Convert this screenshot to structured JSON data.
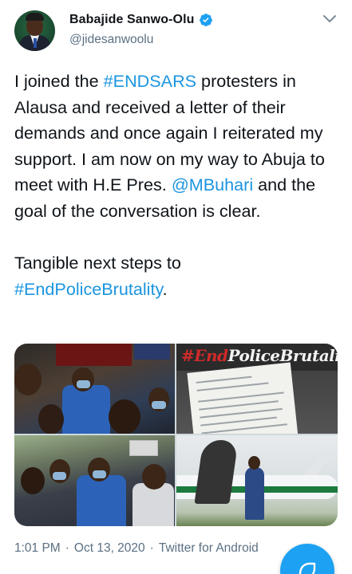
{
  "tweet": {
    "author": {
      "display_name": "Babajide Sanwo-Olu",
      "handle": "@jidesanwoolu",
      "verified": true,
      "avatar_icon": "profile-photo"
    },
    "text": {
      "p1": "I joined the ",
      "p1_link": "#ENDSARS",
      "p2": " protesters in Alausa and received a letter of their demands and once again I reiterated my support. I am now on my way to Abuja to meet with H.E Pres. ",
      "p2_link": "@MBuhari",
      "p3": " and the goal of the conversation is clear.\n\nTangible next steps to\n",
      "p3_link": "#EndPoliceBrutality",
      "p4": "."
    },
    "media": {
      "photo_count": 4,
      "photo2_overlay_hash": "#End",
      "photo2_overlay_rest": "PoliceBrutality"
    },
    "meta": {
      "time": "1:01 PM",
      "separator1": "·",
      "date": "Oct 13, 2020",
      "separator2": "·",
      "source": "Twitter for Android"
    }
  },
  "colors": {
    "link": "#1b95e0",
    "secondary_text": "#5b7083",
    "verified": "#1da1f2",
    "fab": "#1da1f2"
  },
  "icons": {
    "verified": "verified-badge-icon",
    "caret": "chevron-down-icon",
    "fab": "compose-icon"
  }
}
